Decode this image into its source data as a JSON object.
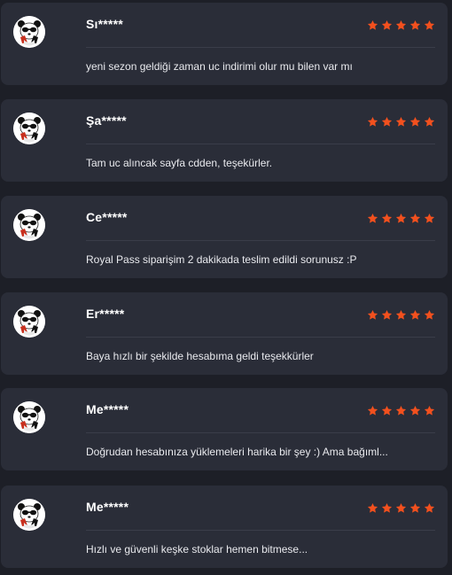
{
  "colors": {
    "background": "#1d1f27",
    "card": "#2a2d38",
    "divider": "#3a3d49",
    "star": "#f2501e",
    "text": "#ffffff"
  },
  "reviews": [
    {
      "name": "Sı*****",
      "rating": 5,
      "text": "yeni sezon geldiği zaman uc indirimi olur mu bilen var mı",
      "avatar_icon": "panda-icon"
    },
    {
      "name": "Şa*****",
      "rating": 5,
      "text": "Tam uc alıncak sayfa cdden, teşekürler.",
      "avatar_icon": "panda-icon"
    },
    {
      "name": "Ce*****",
      "rating": 5,
      "text": "Royal Pass siparişim 2 dakikada teslim edildi sorunusz :P",
      "avatar_icon": "panda-icon"
    },
    {
      "name": "Er*****",
      "rating": 5,
      "text": "Baya hızlı bir şekilde hesabıma geldi teşekkürler",
      "avatar_icon": "panda-icon"
    },
    {
      "name": "Me*****",
      "rating": 5,
      "text": "Doğrudan hesabınıza yüklemeleri harika bir şey :) Ama bağıml...",
      "avatar_icon": "panda-icon"
    },
    {
      "name": "Me*****",
      "rating": 5,
      "text": "Hızlı ve güvenli keşke stoklar hemen bitmese...",
      "avatar_icon": "panda-icon"
    }
  ]
}
